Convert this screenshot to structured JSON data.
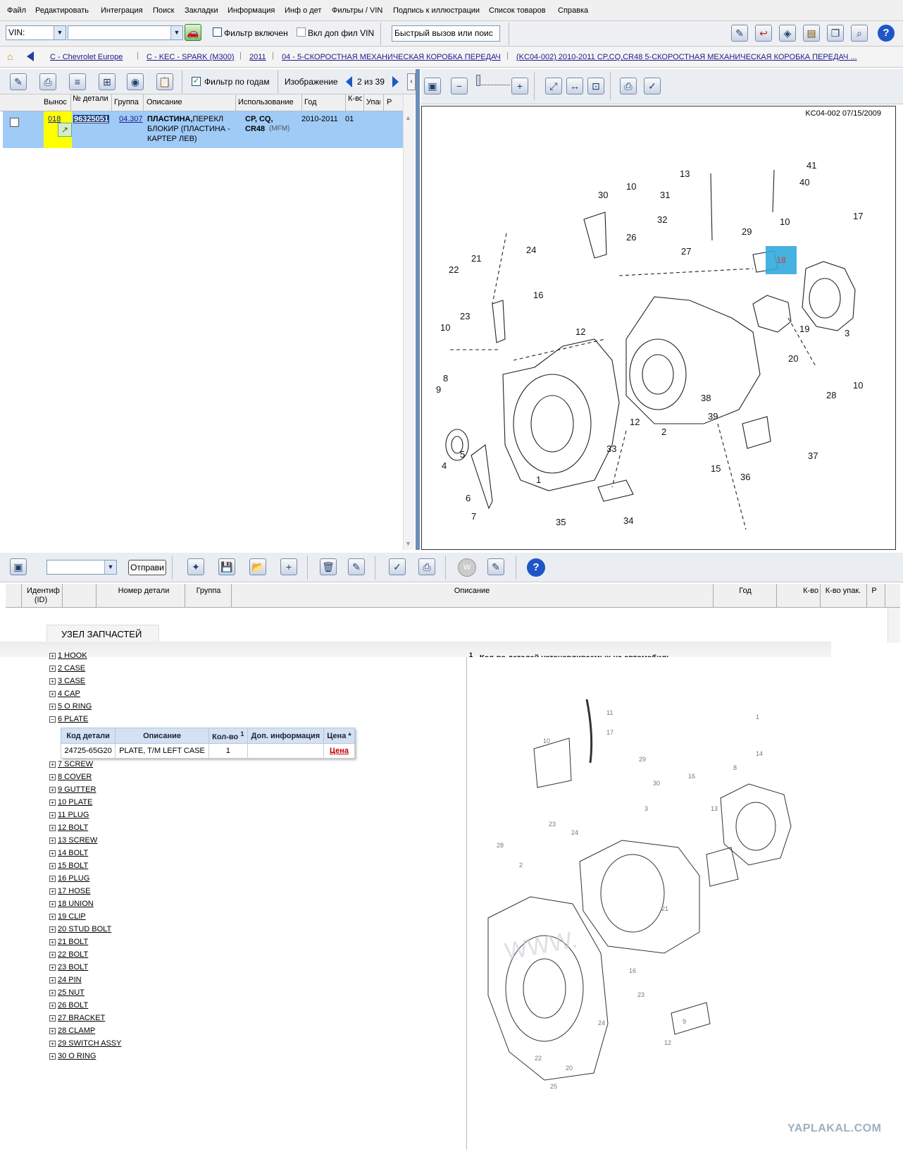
{
  "menu": [
    "Файл",
    "Редактировать",
    "Интеграция",
    "Поиск",
    "Закладки",
    "Информация",
    "Инф о дет",
    "Фильтры / VIN",
    "Подпись к иллюстрации",
    "Список товаров",
    "Справка"
  ],
  "vinbar": {
    "vin_select": "VIN:",
    "filter_label": "Фильтр включен",
    "addvin_label": "Вкл доп фил VIN",
    "quick_call": "Быстрый вызов или поис"
  },
  "breadcrumb": [
    "C - Chevrolet Europe",
    "C - KEC - SPARK (M300)",
    "2011",
    "04 - 5-СКОРОСТНАЯ МЕХАНИЧЕСКАЯ КОРОБКА ПЕРЕДАЧ",
    "(KC04-002)  2010-2011  CP,CQ,CR48 5-СКОРОСТНАЯ МЕХАНИЧЕСКАЯ КОРОБКА ПЕРЕДАЧ ..."
  ],
  "left_toolbar": {
    "filter_years": "Фильтр по годам",
    "image_label": "Изображение",
    "image_counter": "2 из 39"
  },
  "columns": [
    "Вынос",
    "№ детали",
    "Группа",
    "Описание",
    "Использование",
    "Год",
    "К-во",
    "Упак",
    "Р"
  ],
  "row": {
    "callout": "018",
    "part_no": "96325051",
    "group": "04.307",
    "desc_bold": "ПЛАСТИНА,",
    "desc1": " ПЕРЕКЛ",
    "desc2": "БЛОКИР (ПЛАСТИНА -",
    "desc3": "КАРТЕР ЛЕВ)",
    "usage1": "CP, CQ,",
    "usage2": "CR48",
    "usage_note": "(MFM)",
    "year": "2010-2011",
    "qty": "01"
  },
  "diagram": {
    "stamp": "KC04-002 07/15/2009",
    "highlight": "18"
  },
  "bottom_toolbar": {
    "send_label": "Отправи"
  },
  "bottom_columns": [
    "Идентиф (ID)",
    "Номер детали",
    "Группа",
    "Описание",
    "Год",
    "К-во",
    "К-во упак.",
    "Р"
  ],
  "assembly_tab": "УЗЕЛ ЗАПЧАСТЕЙ",
  "legend": "- Кол-во деталей устанавливаемых на автомобиль.",
  "legend_sup": "1",
  "assembly_items": [
    "1 HOOK",
    "2 CASE",
    "3 CASE",
    "4 CAP",
    "5 O RING",
    "6 PLATE",
    "7 SCREW",
    "8 COVER",
    "9 GUTTER",
    "10 PLATE",
    "11 PLUG",
    "12 BOLT",
    "13 SCREW",
    "14 BOLT",
    "15 BOLT",
    "16 PLUG",
    "17 HOSE",
    "18 UNION",
    "19 CLIP",
    "20 STUD BOLT",
    "21 BOLT",
    "22 BOLT",
    "23 BOLT",
    "24 PIN",
    "25 NUT",
    "26 BOLT",
    "27 BRACKET",
    "28 CLAMP",
    "29 SWITCH ASSY",
    "30 O RING"
  ],
  "part_table": {
    "headers": [
      "Код детали",
      "Описание",
      "Кол-во",
      "Доп. информация",
      "Цена"
    ],
    "code": "24725-65G20",
    "desc": "PLATE, T/M LEFT CASE",
    "qty": "1",
    "price": "Цена"
  },
  "watermark": "YAPLAKAL.COM",
  "colors": {
    "highlight_row": "#9fcbf6",
    "callout_yellow": "#ffff00",
    "highlight_part": "#33aadd"
  }
}
